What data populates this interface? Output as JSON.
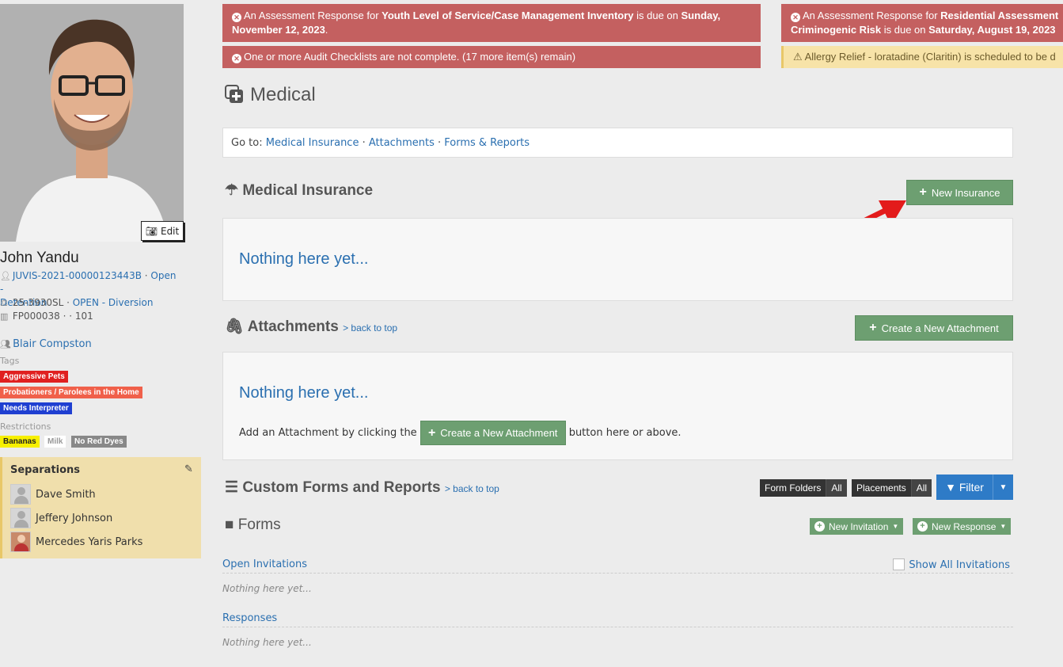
{
  "alerts": {
    "alert1": {
      "prefix": "An Assessment Response for ",
      "bold1": "Youth Level of Service/Case Management Inventory",
      "middle": " is due on ",
      "bold2": "Sunday, November 12, 2023",
      "suffix": "."
    },
    "alert2": {
      "text": "One or more Audit Checklists are not complete. (17 more item(s) remain)"
    },
    "alert3": {
      "prefix": "An Assessment Response for ",
      "bold1": "Residential Assessment",
      "line2_bold": "Criminogenic Risk",
      "middle": " is due on ",
      "bold2": "Saturday, August 19, 2023"
    },
    "alert4": {
      "text": "Allergy Relief - loratadine (Claritin) is scheduled to be d"
    }
  },
  "profile": {
    "edit_label": "Edit",
    "name": "John Yandu",
    "case_id": "JUVIS-2021-00000123443B",
    "case_status_1": "Open -",
    "case_status_2": "Detention",
    "docket": "25-3930SL",
    "docket_status": "OPEN - Diversion",
    "facility": "FP000038 · · 101",
    "worker": "Blair Compston",
    "tags_label": "Tags",
    "tags": [
      "Aggressive Pets",
      "Probationers / Parolees in the Home",
      "Needs Interpreter"
    ],
    "restrictions_label": "Restrictions",
    "restrictions": [
      "Bananas",
      "Milk",
      "No Red Dyes"
    ]
  },
  "separations": {
    "title": "Separations",
    "people": [
      "Dave Smith",
      "Jeffery Johnson",
      "Mercedes Yaris Parks"
    ]
  },
  "page": {
    "title": "Medical",
    "goto_label": "Go to: ",
    "goto_links": [
      "Medical Insurance",
      "Attachments",
      "Forms & Reports"
    ],
    "sep": " · "
  },
  "insurance": {
    "title": "Medical Insurance",
    "new_button": "New Insurance",
    "empty": "Nothing here yet..."
  },
  "attachments": {
    "title": "Attachments",
    "back_to_top": "> back to top",
    "new_button": "Create a New Attachment",
    "empty": "Nothing here yet...",
    "hint_before": "Add an Attachment by clicking the",
    "hint_button": "Create a New Attachment",
    "hint_after": "button here or above."
  },
  "forms": {
    "section_title": "Custom Forms and Reports",
    "back_to_top": "> back to top",
    "form_folders": "Form Folders",
    "placements": "Placements",
    "all": "All",
    "filter": "Filter",
    "forms_title": "Forms",
    "new_invitation": "New Invitation",
    "new_response": "New Response",
    "open_invitations": "Open Invitations",
    "show_all_invitations": "Show All Invitations",
    "nothing": "Nothing here yet...",
    "responses": "Responses"
  },
  "colors": {
    "alert_red": "#c46060",
    "btn_green": "#6d9f71",
    "link_blue": "#2a6fb0",
    "filter_blue": "#2e7bc7",
    "tag_red": "#e02020",
    "tag_orange": "#f0604a",
    "tag_blue": "#1f3fd1",
    "restr_yellow": "#f7f000",
    "restr_gray": "#888888"
  }
}
